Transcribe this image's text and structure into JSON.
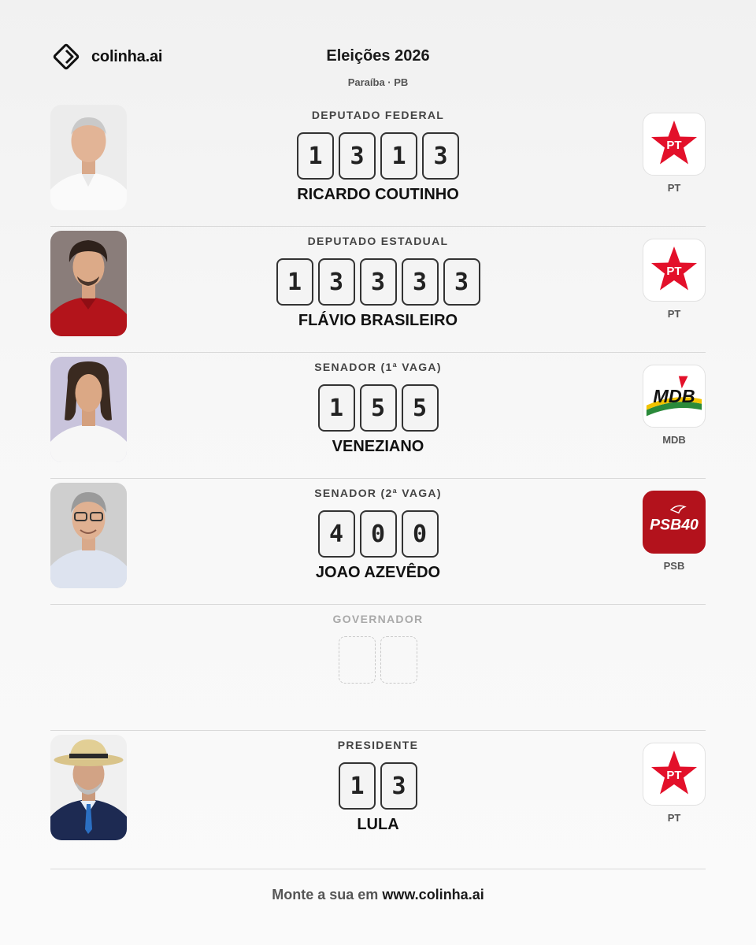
{
  "brand": {
    "name": "colinha.ai",
    "logo_icon": "diamond-logo-icon"
  },
  "header": {
    "title": "Eleições 2026",
    "subtitle": "Paraíba · PB"
  },
  "ballot": [
    {
      "office": "DEPUTADO FEDERAL",
      "number": [
        "1",
        "3",
        "1",
        "3"
      ],
      "candidate": "RICARDO COUTINHO",
      "party": "PT",
      "party_logo_text": "PT"
    },
    {
      "office": "DEPUTADO ESTADUAL",
      "number": [
        "1",
        "3",
        "3",
        "3",
        "3"
      ],
      "candidate": "FLÁVIO BRASILEIRO",
      "party": "PT",
      "party_logo_text": "PT"
    },
    {
      "office": "SENADOR (1ª VAGA)",
      "number": [
        "1",
        "5",
        "5"
      ],
      "candidate": "VENEZIANO",
      "party": "MDB",
      "party_logo_text": "MDB"
    },
    {
      "office": "SENADOR (2ª VAGA)",
      "number": [
        "4",
        "0",
        "0"
      ],
      "candidate": "JOAO AZEVÊDO",
      "party": "PSB",
      "party_logo_text": "PSB40"
    },
    {
      "office": "GOVERNADOR",
      "number": [
        "",
        ""
      ],
      "candidate": "",
      "party": "",
      "party_logo_text": ""
    },
    {
      "office": "PRESIDENTE",
      "number": [
        "1",
        "3"
      ],
      "candidate": "LULA",
      "party": "PT",
      "party_logo_text": "PT"
    }
  ],
  "footer": {
    "prefix": "Monte a sua em",
    "url": "www.colinha.ai"
  },
  "colors": {
    "pt_red": "#e3102a",
    "psb_red": "#b3121c",
    "mdb_green": "#2a8a3a",
    "mdb_yellow": "#f2c300"
  }
}
